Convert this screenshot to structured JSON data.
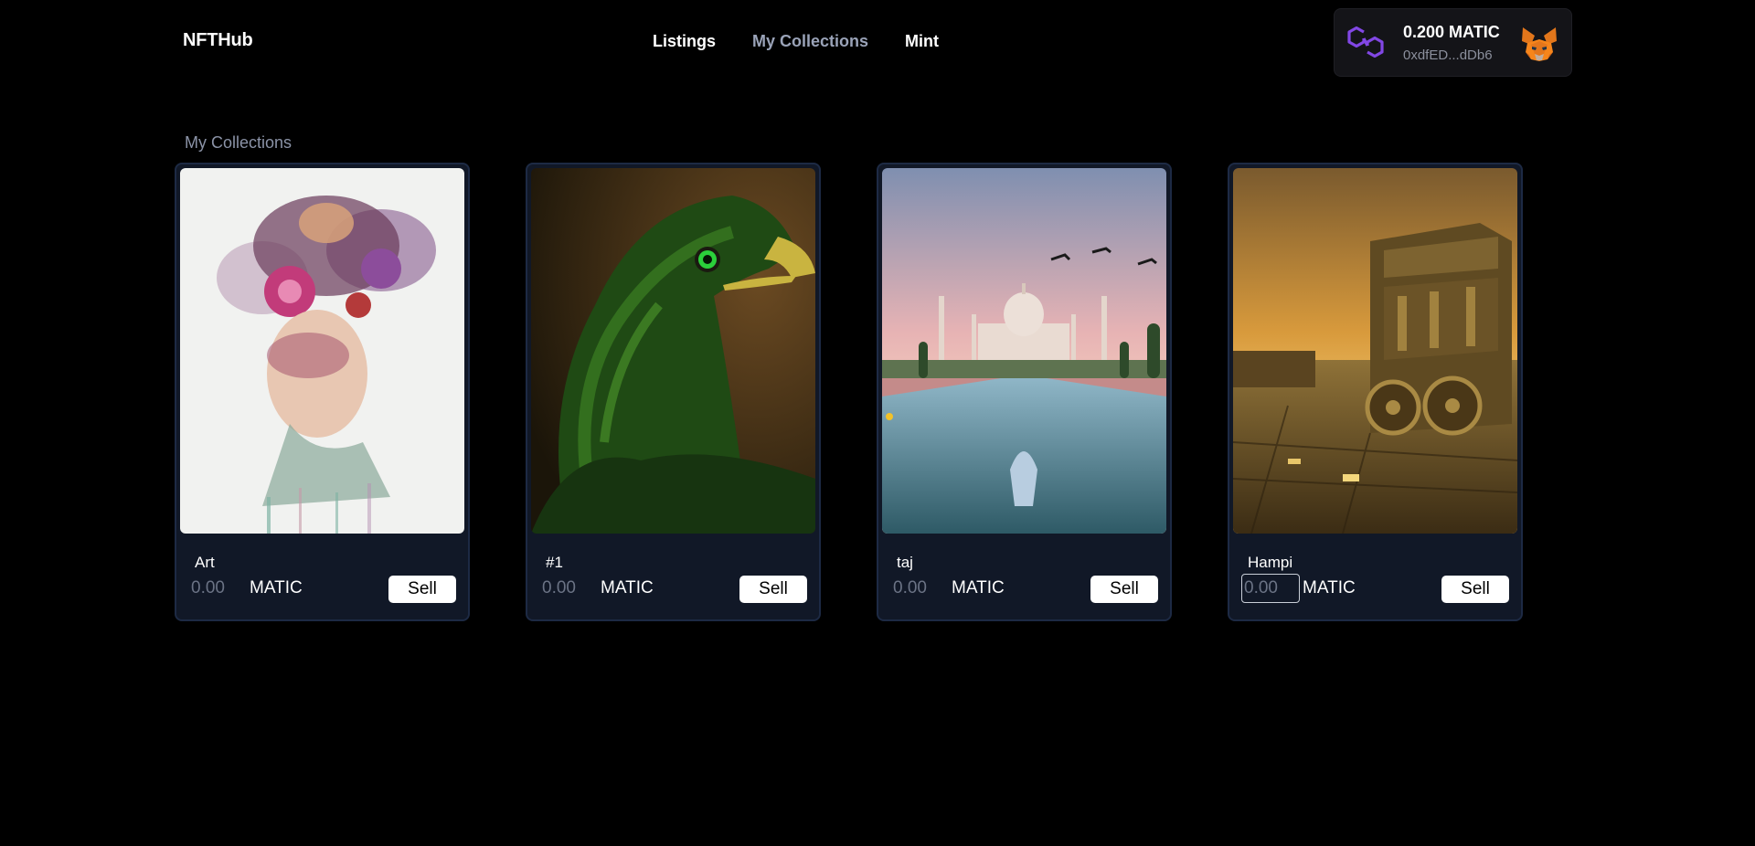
{
  "header": {
    "brand": "NFTHub",
    "nav": [
      {
        "label": "Listings",
        "active": false
      },
      {
        "label": "My Collections",
        "active": true
      },
      {
        "label": "Mint",
        "active": false
      }
    ],
    "wallet": {
      "balance": "0.200 MATIC",
      "address": "0xdfED...dDb6",
      "chain_icon": "polygon-icon",
      "wallet_icon": "metamask-fox-icon"
    }
  },
  "main": {
    "section_title": "My Collections",
    "cards": [
      {
        "name": "Art",
        "price_placeholder": "0.00",
        "currency": "MATIC",
        "sell_label": "Sell",
        "image": "watercolor-floral-woman-portrait"
      },
      {
        "name": "#1",
        "price_placeholder": "0.00",
        "currency": "MATIC",
        "sell_label": "Sell",
        "image": "green-eagle-portrait"
      },
      {
        "name": "taj",
        "price_placeholder": "0.00",
        "currency": "MATIC",
        "sell_label": "Sell",
        "image": "taj-mahal-reflecting-pool"
      },
      {
        "name": "Hampi",
        "price_placeholder": "0.00",
        "currency": "MATIC",
        "sell_label": "Sell",
        "image": "hampi-stone-chariot-sunset"
      }
    ]
  },
  "colors": {
    "background": "#000000",
    "card_bg": "#111827",
    "card_border": "#1d2a44",
    "nav_active": "#9aa3b8",
    "polygon_purple": "#8247e5"
  }
}
